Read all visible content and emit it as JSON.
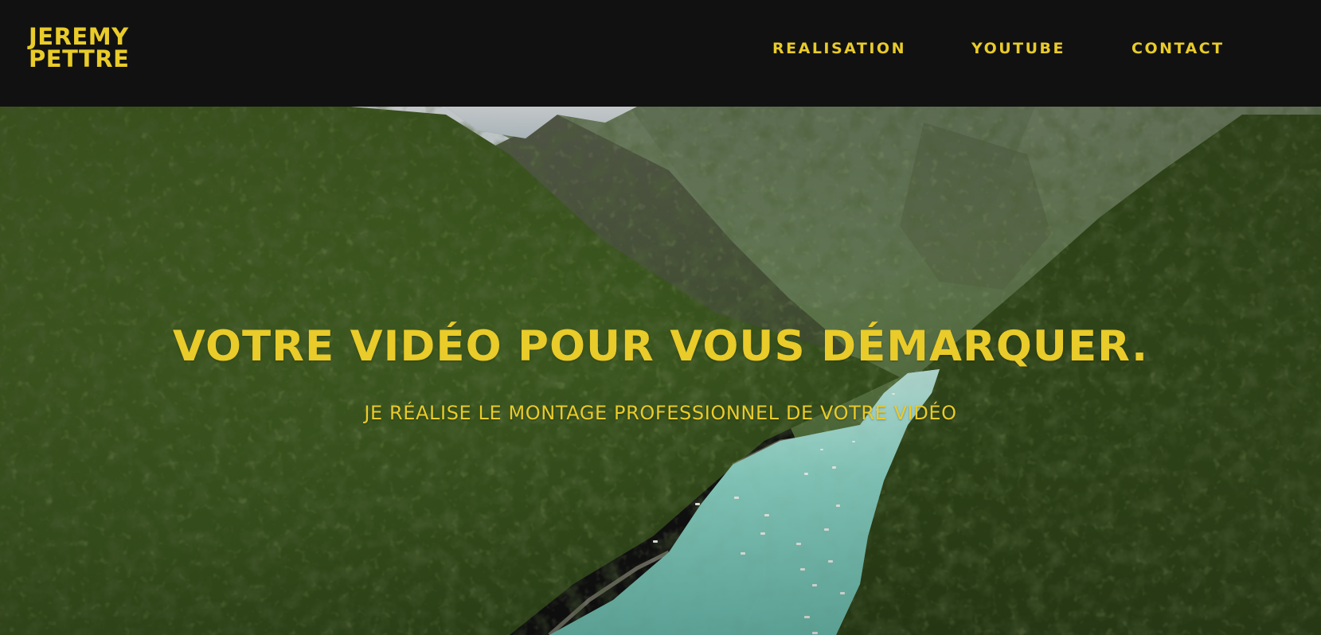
{
  "brand": {
    "line1": "JEREMY",
    "line2": "PETTRE"
  },
  "nav": {
    "items": [
      {
        "label": "REALISATION"
      },
      {
        "label": "YOUTUBE"
      },
      {
        "label": "CONTACT"
      }
    ]
  },
  "hero": {
    "title": "VOTRE VIDÉO POUR VOUS DÉMARQUER.",
    "subtitle": "JE RÉALISE LE MONTAGE PROFESSIONNEL DE VOTRE VIDÉO"
  },
  "colors": {
    "accent": "#E9CB2A",
    "header_bg": "#111111",
    "forest": "#3F5A22",
    "river": "#7CCDBF",
    "sky": "#DDE6EA"
  }
}
